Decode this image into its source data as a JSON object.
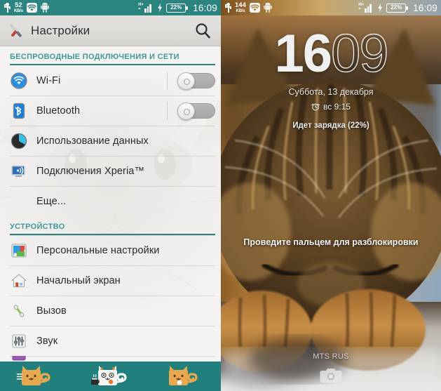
{
  "theme": {
    "teal": "#2b8480",
    "teal_nav": "#21807e",
    "section_text": "#3f9a96",
    "settings_bg": "#f4f3f1",
    "cat_orange": "#eaa84e",
    "cat_white": "#f7f7f5"
  },
  "left_panel": {
    "statusbar": {
      "usb_icon": "usb-icon",
      "data_rate_value": "52",
      "data_rate_unit": "KB/s",
      "wifi_icon": "wifi-icon",
      "android_icon": "android-robot-icon",
      "network_type": "H+",
      "signal_icon": "signal-bars-icon",
      "charging_icon": "charging-bolt-icon",
      "battery_percent": "22%",
      "clock": "16:09"
    },
    "titlebar": {
      "icon": "settings-tools-icon",
      "title": "Настройки",
      "search_icon": "search-icon"
    },
    "sections": [
      {
        "header": "БЕСПРОВОДНЫЕ ПОДКЛЮЧЕНИЯ И СЕТИ",
        "items": [
          {
            "icon": "wifi-icon",
            "label": "Wi-Fi",
            "control": "switch",
            "switch_state": "off"
          },
          {
            "icon": "bluetooth-icon",
            "label": "Bluetooth",
            "control": "switch",
            "switch_state": "off"
          },
          {
            "icon": "data-usage-icon",
            "label": "Использование данных",
            "control": "none"
          },
          {
            "icon": "xperia-connect-icon",
            "label": "Подключения Xperia™",
            "control": "none"
          },
          {
            "icon": "none",
            "label": "Еще...",
            "control": "none"
          }
        ]
      },
      {
        "header": "УСТРОЙСТВО",
        "items": [
          {
            "icon": "personalization-icon",
            "label": "Персональные настройки",
            "control": "none"
          },
          {
            "icon": "home-screen-icon",
            "label": "Начальный экран",
            "control": "none"
          },
          {
            "icon": "call-icon",
            "label": "Вызов",
            "control": "none"
          },
          {
            "icon": "sound-sliders-icon",
            "label": "Звук",
            "control": "none"
          }
        ]
      }
    ],
    "navbar": {
      "back": {
        "icon": "cat-back-icon",
        "label": "Назад"
      },
      "home": {
        "icon": "cat-coffee-home-icon",
        "label": "Главный экран"
      },
      "recents": {
        "icon": "cat-recents-icon",
        "label": "Недавние приложения"
      }
    }
  },
  "right_panel": {
    "statusbar": {
      "usb_icon": "usb-icon",
      "data_rate_value": "144",
      "data_rate_unit": "KB/s",
      "wifi_icon": "wifi-icon",
      "android_icon": "android-robot-icon",
      "network_type": "H+",
      "signal_icon": "signal-bars-icon",
      "charging_icon": "charging-bolt-icon",
      "battery_percent": "22%",
      "clock": "16:09"
    },
    "lockscreen": {
      "clock_hours": "16",
      "clock_minutes": "09",
      "date": "Суббота, 13 декабря",
      "alarm_icon": "alarm-clock-icon",
      "alarm_time": "вс 9:15",
      "charging_status": "Идет зарядка (22%)",
      "unlock_hint": "Проведите пальцем для разблокировки",
      "carrier": "MTS RUS",
      "camera_icon": "camera-icon",
      "wallpaper": "sleeping-tabby-kitten-photo"
    }
  }
}
